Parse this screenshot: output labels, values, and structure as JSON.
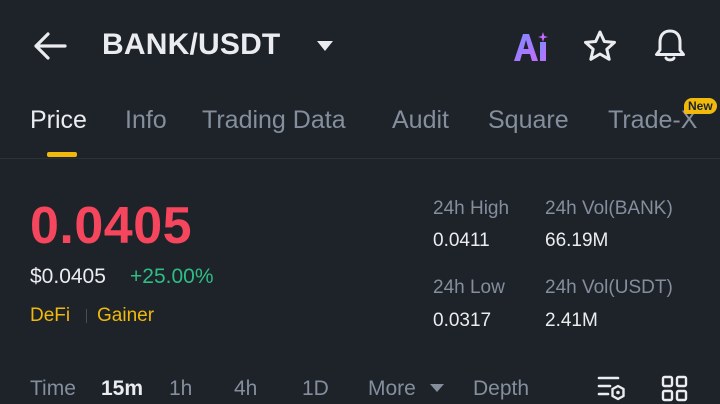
{
  "header": {
    "back_icon": "arrow-left-icon",
    "title": "BANK/USDT",
    "dropdown_icon": "caret-down-icon",
    "ai_label": "Ai",
    "star_icon": "star-icon",
    "bell_icon": "bell-icon"
  },
  "tabs": [
    {
      "label": "Price",
      "active": true
    },
    {
      "label": "Info"
    },
    {
      "label": "Trading Data"
    },
    {
      "label": "Audit"
    },
    {
      "label": "Square"
    },
    {
      "label": "Trade-X",
      "badge": "New"
    }
  ],
  "price": {
    "last": "0.0405",
    "usd": "$0.0405",
    "change": "+25.00%",
    "tags": [
      "DeFi",
      "Gainer"
    ]
  },
  "stats": {
    "high_label": "24h High",
    "high_value": "0.0411",
    "vol_base_label": "24h Vol(BANK)",
    "vol_base_value": "66.19M",
    "low_label": "24h Low",
    "low_value": "0.0317",
    "vol_quote_label": "24h Vol(USDT)",
    "vol_quote_value": "2.41M"
  },
  "timeframes": {
    "time_label": "Time",
    "items": [
      "15m",
      "1h",
      "4h",
      "1D"
    ],
    "active": "15m",
    "more_label": "More",
    "depth_label": "Depth"
  },
  "colors": {
    "background": "#1e2329",
    "accent": "#f0b90b",
    "down": "#f6465d",
    "up": "#2ebd85"
  }
}
